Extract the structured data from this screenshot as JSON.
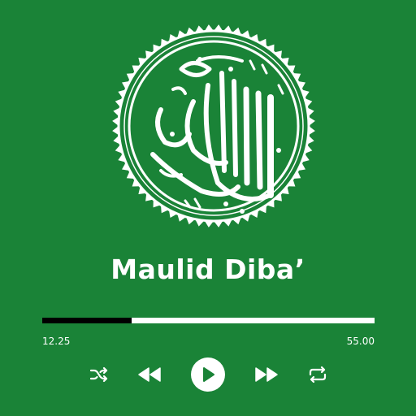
{
  "player": {
    "title": "Maulid Diba’",
    "artwork_icon": "arabic-calligraphy-emblem",
    "progress_fraction": 0.27,
    "elapsed": "12.25",
    "total": "55.00"
  },
  "controls": {
    "shuffle_icon": "shuffle-icon",
    "previous_icon": "previous-icon",
    "play_icon": "play-icon",
    "next_icon": "next-icon",
    "repeat_icon": "repeat-icon"
  },
  "colors": {
    "background": "#1a8337",
    "foreground": "#ffffff",
    "progress_fill": "#000000"
  }
}
